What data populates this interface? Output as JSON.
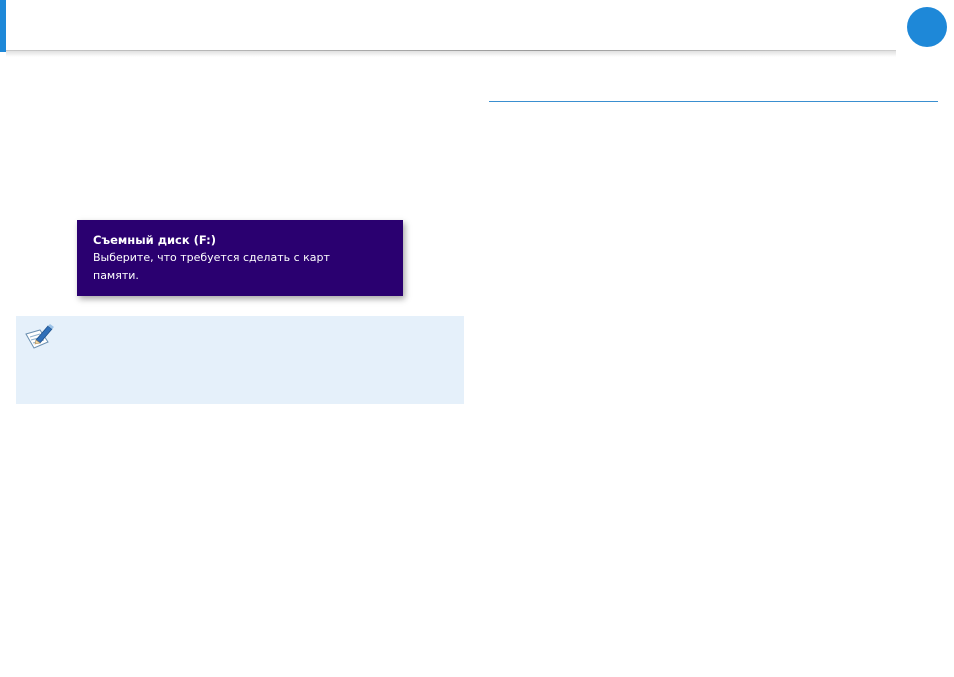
{
  "notification": {
    "title": "Съемный диск (F:)",
    "body": "Выберите, что требуется сделать с карт памяти."
  },
  "note": {
    "icon": "note-pencil-icon"
  },
  "colors": {
    "accent": "#1e88d8",
    "notification_bg": "#2a0070",
    "note_bg": "#e5f0fa"
  }
}
